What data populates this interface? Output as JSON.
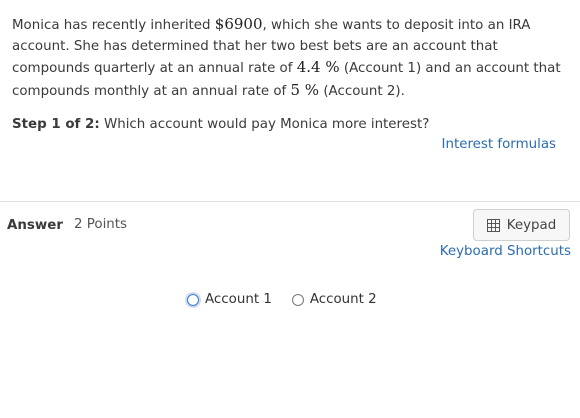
{
  "question": {
    "p1": "Monica has recently inherited ",
    "amount": "$6900",
    "p2": ", which she wants to deposit into an IRA account. She has determined that her two best bets are an account that compounds quarterly at an annual rate of ",
    "rate1": "4.4 %",
    "p3": " (Account 1) and an account that compounds monthly at an annual rate of ",
    "rate2": "5 %",
    "p4": " (Account 2)."
  },
  "step": {
    "label": "Step 1 of 2:",
    "text": " Which account would pay Monica more interest?"
  },
  "links": {
    "interest_formulas": "Interest formulas",
    "keyboard_shortcuts": "Keyboard Shortcuts"
  },
  "answer": {
    "label": "Answer",
    "points": "2 Points"
  },
  "keypad": {
    "label": "Keypad",
    "icon": "keypad-icon"
  },
  "options": [
    {
      "label": "Account 1",
      "selected": false,
      "focused": true
    },
    {
      "label": "Account 2",
      "selected": false,
      "focused": false
    }
  ]
}
